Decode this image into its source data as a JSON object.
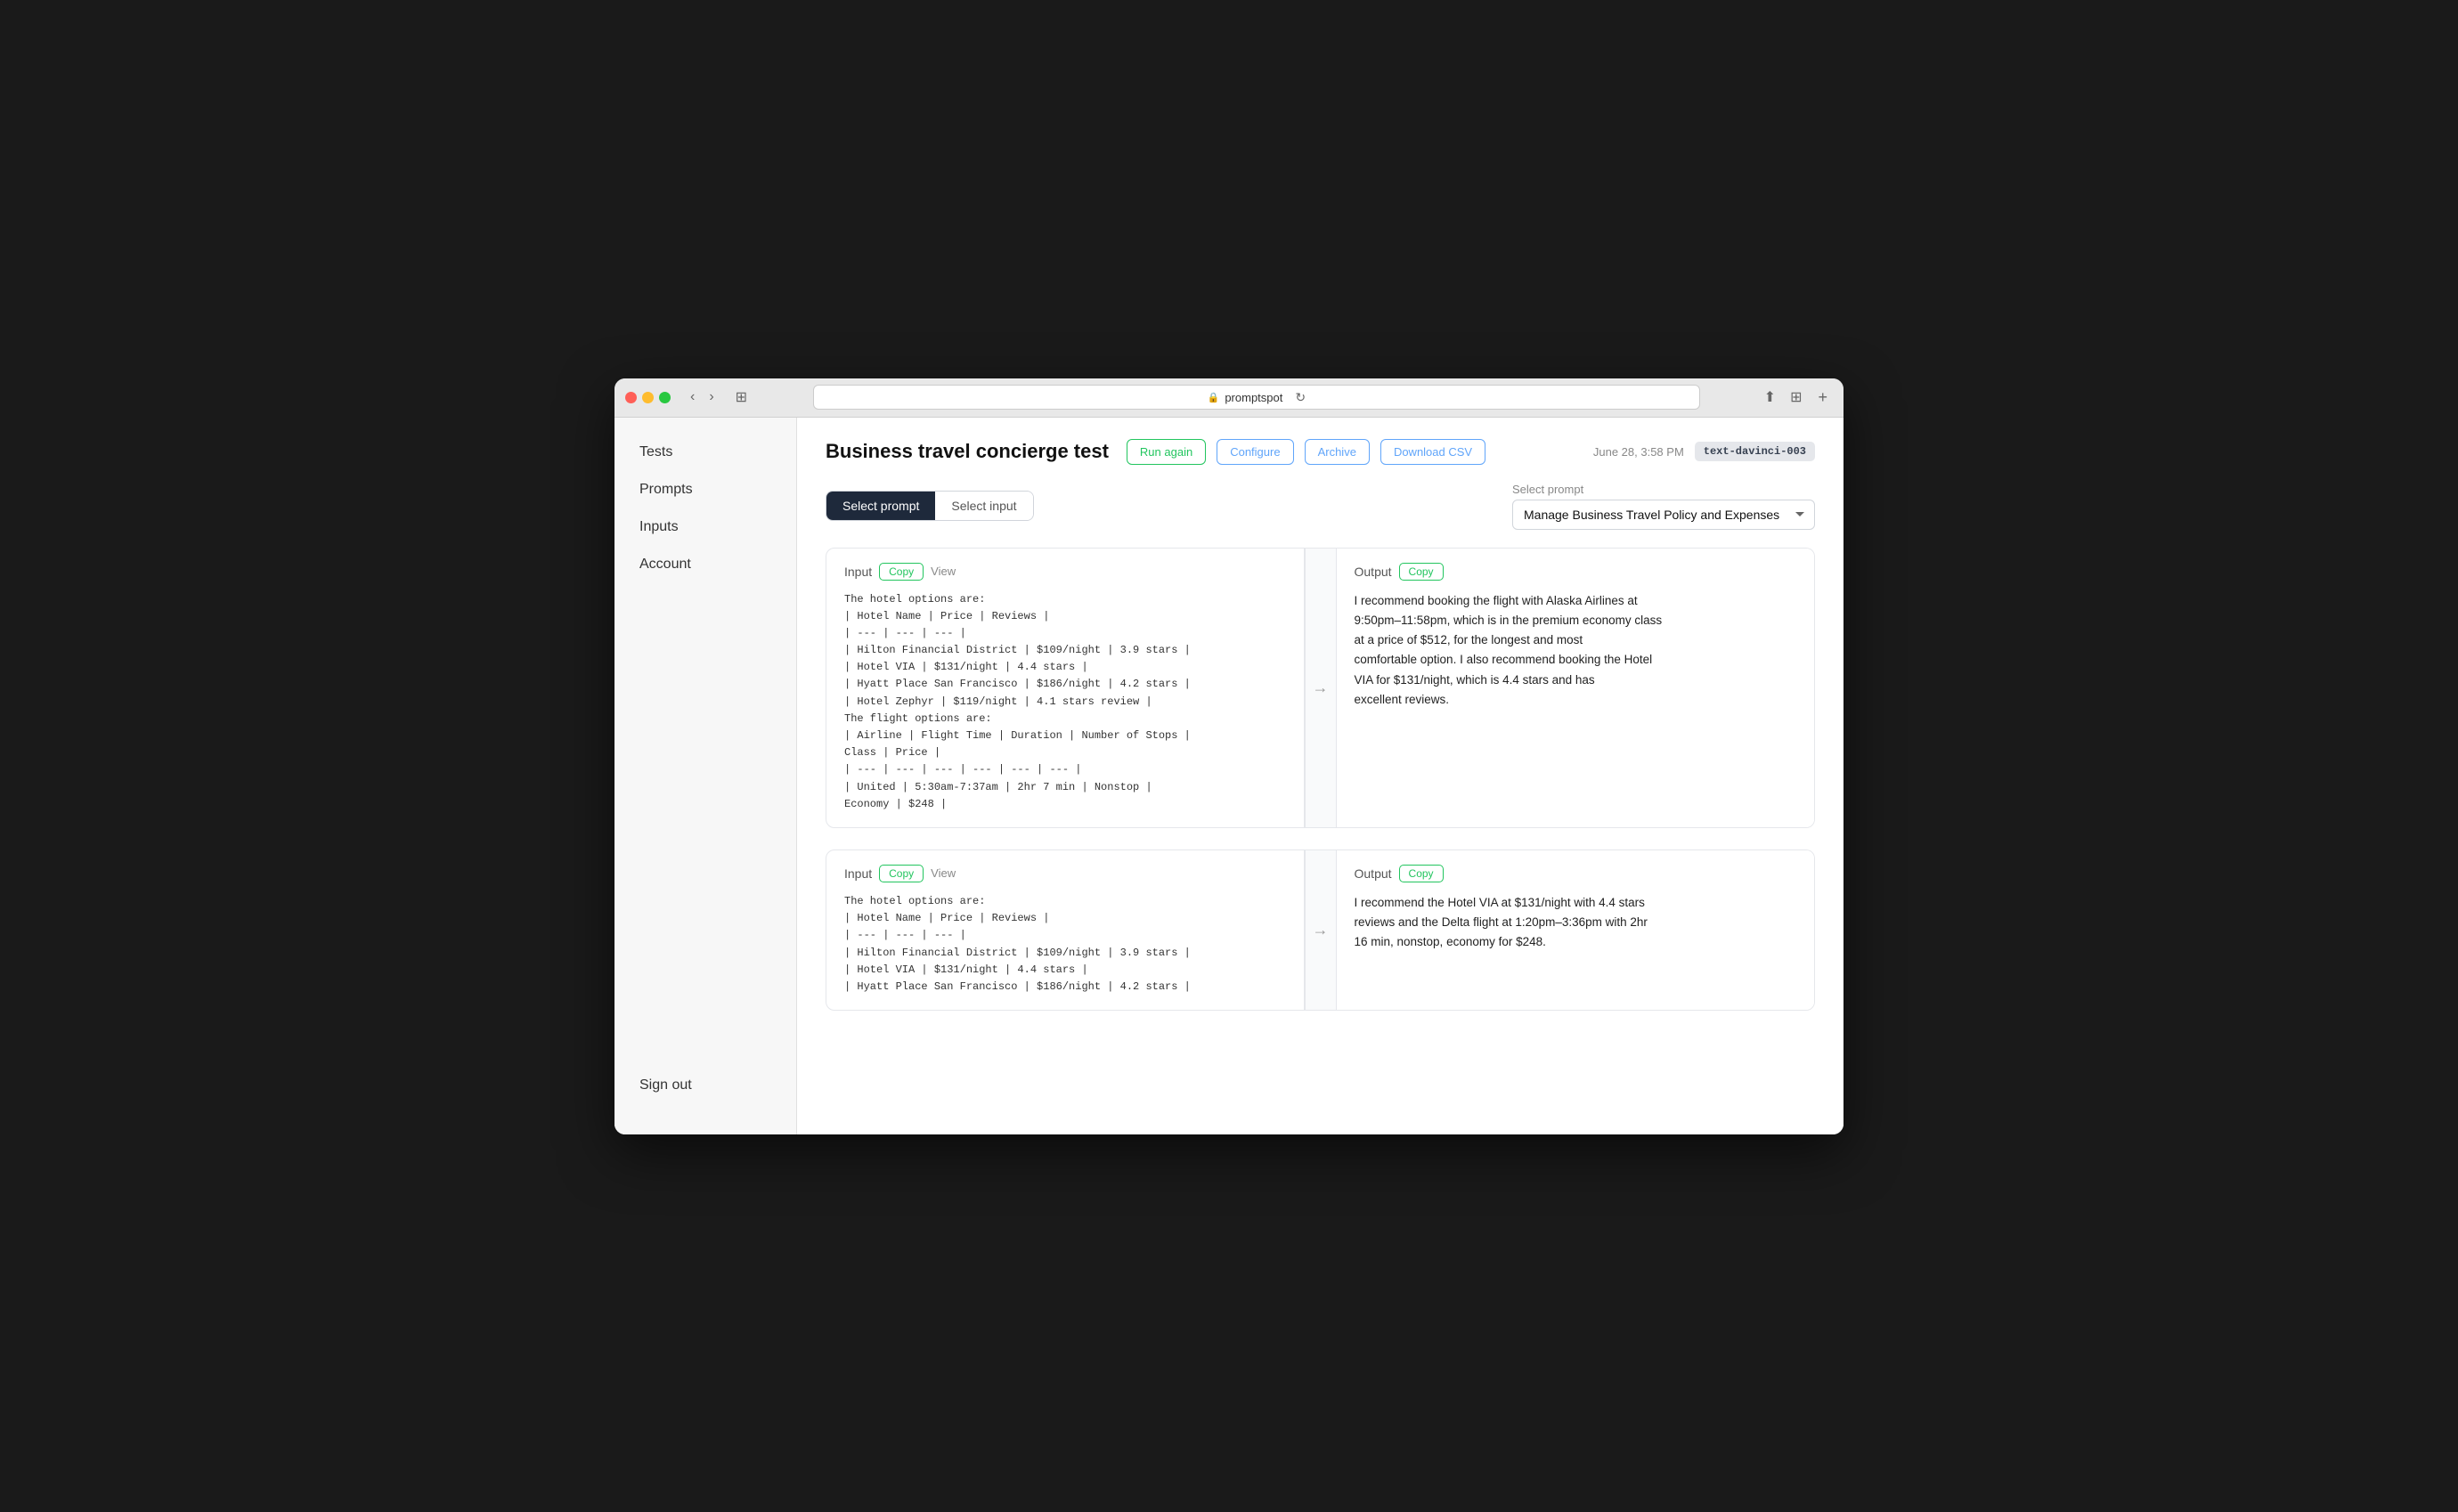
{
  "titlebar": {
    "url": "promptspot",
    "lock_icon": "🔒",
    "reload_icon": "↻"
  },
  "sidebar": {
    "items": [
      {
        "label": "Tests",
        "id": "tests"
      },
      {
        "label": "Prompts",
        "id": "prompts"
      },
      {
        "label": "Inputs",
        "id": "inputs"
      },
      {
        "label": "Account",
        "id": "account"
      }
    ],
    "signout_label": "Sign out"
  },
  "header": {
    "title": "Business travel concierge test",
    "run_again": "Run again",
    "configure": "Configure",
    "archive": "Archive",
    "download_csv": "Download CSV",
    "timestamp": "June 28, 3:58 PM",
    "model": "text-davinci-003"
  },
  "prompt_selector": {
    "tab_prompt": "Select prompt",
    "tab_input": "Select input",
    "select_label": "Select prompt",
    "selected_value": "Manage Business Travel Policy and Expenses",
    "dropdown_options": [
      "Manage Business Travel Policy and Expenses"
    ]
  },
  "io_pairs": [
    {
      "input_label": "Input",
      "copy_label": "Copy",
      "view_label": "View",
      "input_text": "The hotel options are:\n| Hotel Name | Price | Reviews |\n| --- | --- | --- |\n| Hilton Financial District | $109/night | 3.9 stars |\n| Hotel VIA | $131/night | 4.4 stars |\n| Hyatt Place San Francisco | $186/night | 4.2 stars |\n| Hotel Zephyr | $119/night | 4.1 stars review |\nThe flight options are:\n| Airline | Flight Time | Duration | Number of Stops |\nClass | Price |\n| --- | --- | --- | --- | --- | --- |\n| United | 5:30am-7:37am | 2hr 7 min | Nonstop |\nEconomy | $248 |",
      "output_label": "Output",
      "output_copy_label": "Copy",
      "output_text": "I recommend booking the flight with Alaska Airlines at\n9:50pm–11:58pm, which is in the premium economy class\nat a price of $512, for the longest and most\ncomfortable option. I also recommend booking the Hotel\nVIA for $131/night, which is 4.4 stars and has\nexcellent reviews."
    },
    {
      "input_label": "Input",
      "copy_label": "Copy",
      "view_label": "View",
      "input_text": "The hotel options are:\n| Hotel Name | Price | Reviews |\n| --- | --- | --- |\n| Hilton Financial District | $109/night | 3.9 stars |\n| Hotel VIA | $131/night | 4.4 stars |\n| Hyatt Place San Francisco | $186/night | 4.2 stars |",
      "output_label": "Output",
      "output_copy_label": "Copy",
      "output_text": "I recommend the Hotel VIA at $131/night with 4.4 stars\nreviews and the Delta flight at 1:20pm–3:36pm with 2hr\n16 min, nonstop, economy for $248."
    }
  ]
}
